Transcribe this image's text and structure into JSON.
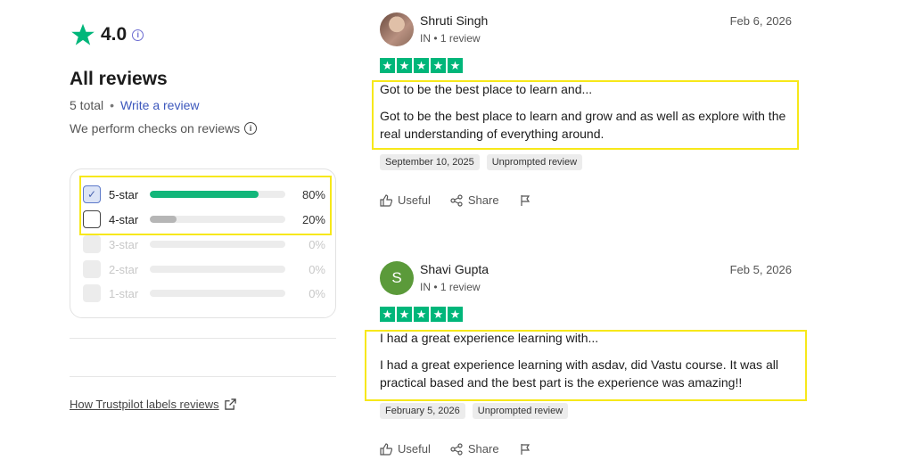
{
  "summary": {
    "rating": "4.0",
    "heading": "All reviews",
    "total": "5 total",
    "write_review": "Write a review",
    "checks_text": "We perform checks on reviews",
    "star_color": "#00b67a"
  },
  "filters": [
    {
      "label": "5-star",
      "percent": "80%",
      "fill": 0.8,
      "checked": true,
      "disabled": false,
      "color": "#12b67a"
    },
    {
      "label": "4-star",
      "percent": "20%",
      "fill": 0.2,
      "checked": false,
      "disabled": false,
      "color": "#b6b6b6"
    },
    {
      "label": "3-star",
      "percent": "0%",
      "fill": 0,
      "checked": false,
      "disabled": true,
      "color": "#b6b6b6"
    },
    {
      "label": "2-star",
      "percent": "0%",
      "fill": 0,
      "checked": false,
      "disabled": true,
      "color": "#b6b6b6"
    },
    {
      "label": "1-star",
      "percent": "0%",
      "fill": 0,
      "checked": false,
      "disabled": true,
      "color": "#b6b6b6"
    }
  ],
  "how_link": "How Trustpilot labels reviews",
  "reviews": [
    {
      "name": "Shruti Singh",
      "meta": "IN • 1 review",
      "date": "Feb 6, 2026",
      "rating": 5,
      "title": "Got to be the best place to learn and...",
      "body": "Got to be the best place to learn and grow and as well as explore with the real understanding of everything around.",
      "experience_date": "September 10, 2025",
      "label": "Unprompted review",
      "useful": "Useful",
      "share": "Share"
    },
    {
      "name": "Shavi Gupta",
      "initial": "S",
      "meta": "IN • 1 review",
      "date": "Feb 5, 2026",
      "rating": 5,
      "title": "I had a great experience learning with...",
      "body": "I had a great experience learning with asdav, did Vastu course. It was all practical based and the best part is the experience was amazing!!",
      "experience_date": "February 5, 2026",
      "label": "Unprompted review",
      "useful": "Useful",
      "share": "Share"
    }
  ]
}
